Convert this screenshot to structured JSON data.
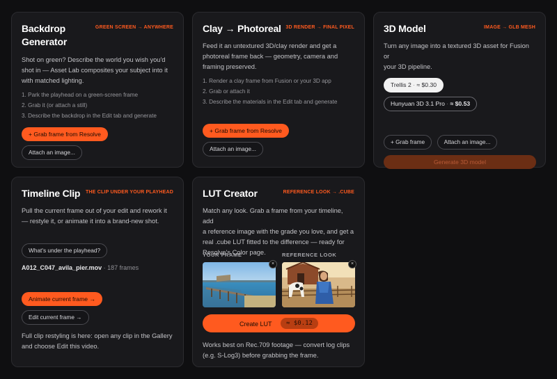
{
  "cards": {
    "backdrop": {
      "title_line1": "Backdrop",
      "title_line2": "Generator",
      "tag": "GREEN SCREEN → ANYWHERE",
      "desc": [
        "Shot on green? Describe the world you wish you'd",
        "shot in — Asset Lab composites your subject into it",
        "with matched lighting."
      ],
      "steps": [
        "1. Park the playhead on a green-screen frame",
        "2. Grab it (or attach a still)",
        "3. Describe the backdrop in the Edit tab and generate"
      ],
      "primary_button": "+ Grab frame from Resolve",
      "secondary_button": "Attach an image..."
    },
    "clay": {
      "title": "Clay → Photoreal",
      "tag": "3D RENDER → FINAL PIXEL",
      "desc": [
        "Feed it an untextured 3D/clay render and get a",
        "photoreal frame back — geometry, camera and",
        "framing preserved."
      ],
      "steps": [
        "1. Render a clay frame from Fusion or your 3D app",
        "2. Grab or attach it",
        "3. Describe the materials in the Edit tab and generate"
      ],
      "primary_button": "+ Grab frame from Resolve",
      "secondary_button": "Attach an image..."
    },
    "model3d": {
      "title": "3D Model",
      "tag": "IMAGE → GLB MESH",
      "desc": [
        "Turn any image into a textured 3D asset for Fusion or",
        "your 3D pipeline."
      ],
      "options": [
        {
          "name": "Trellis 2",
          "price": "≈ $0.30",
          "selected": true
        },
        {
          "name": "Hunyuan 3D 3.1 Pro",
          "price": "≈ $0.53",
          "selected": false
        }
      ],
      "grab_button": "+ Grab frame",
      "attach_button": "Attach an image...",
      "generate_button": "Generate 3D model"
    },
    "timeline": {
      "title": "Timeline Clip",
      "tag": "THE CLIP UNDER YOUR PLAYHEAD",
      "desc": [
        "Pull the current frame out of your edit and rework it",
        "— restyle it, or animate it into a brand-new shot."
      ],
      "query_button": "What's under the playhead?",
      "clip_name": "A012_C047_avila_pier.mov",
      "clip_frames": "· 187 frames",
      "animate_button": "Animate current frame →",
      "edit_button": "Edit current frame →",
      "footer": [
        "Full clip restyling is here: open any clip in the Gallery",
        "and choose Edit this video."
      ]
    },
    "lut": {
      "title": "LUT Creator",
      "tag": "REFERENCE LOOK → .CUBE",
      "desc": [
        "Match any look. Grab a frame from your timeline, add",
        "a reference image with the grade you love, and get a",
        "real .cube LUT fitted to the difference — ready for",
        "Resolve's Color page."
      ],
      "your_frame_label": "YOUR FRAME",
      "reference_label": "REFERENCE LOOK",
      "create_button": "Create LUT",
      "create_price": "≈ $0.12",
      "footer": [
        "Works best on Rec.709 footage — convert log clips",
        "(e.g. S-Log3) before grabbing the frame."
      ]
    }
  },
  "colors": {
    "accent": "#ff5a1f",
    "generate_disabled": "#6b2e14",
    "card_bg": "#19191c",
    "page_bg": "#0f0f11"
  },
  "icons": {
    "close": "×"
  }
}
